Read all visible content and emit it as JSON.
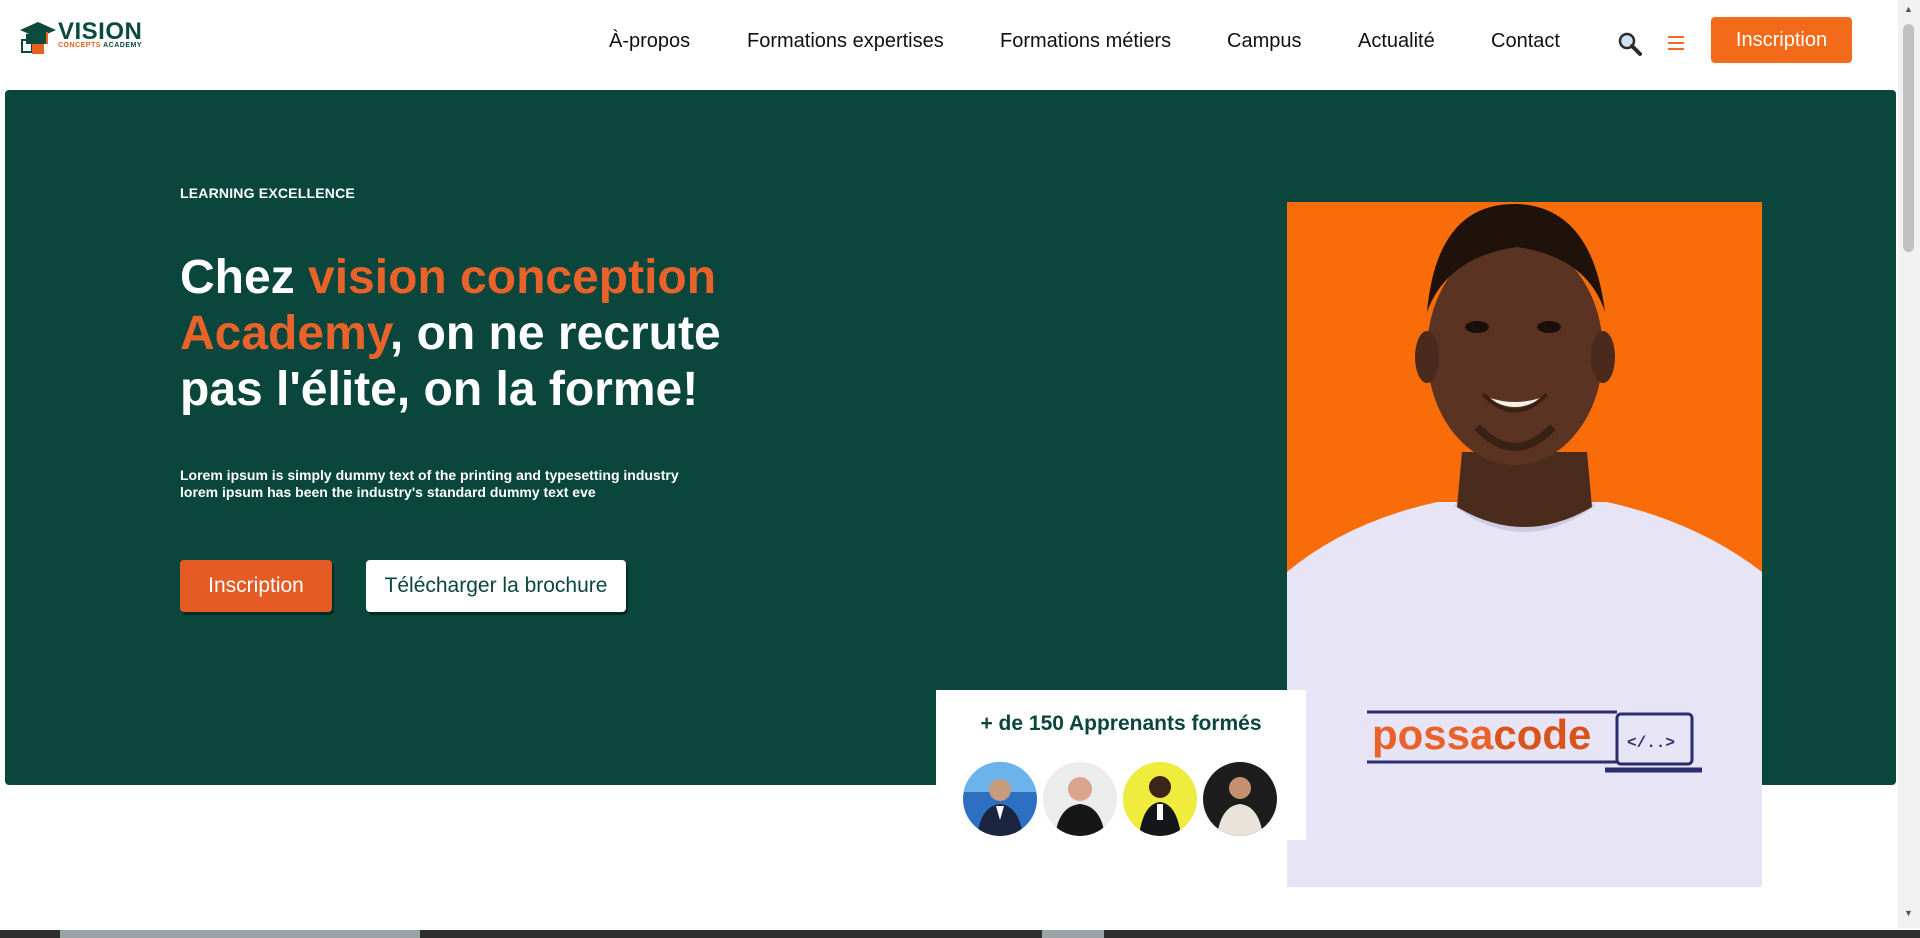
{
  "header": {
    "logo": {
      "main": "VISION",
      "sub_left": "CONCEPTS",
      "sub_right": "ACADEMY"
    },
    "nav": [
      "À-propos",
      "Formations expertises",
      "Formations métiers",
      "Campus",
      "Actualité",
      "Contact"
    ],
    "icons": [
      "search-icon",
      "menu-icon"
    ],
    "cta_label": "Inscription"
  },
  "hero": {
    "eyebrow": "LEARNING EXCELLENCE",
    "headline_pre": "Chez ",
    "headline_highlight": "vision conception Academy",
    "headline_post": ", on ne recrute pas l'élite, on la forme!",
    "description_line1": "Lorem ipsum is simply dummy text of the printing and typesetting industry",
    "description_line2": "lorem ipsum has been the industry's standard dummy text eve",
    "primary_button": "Inscription",
    "secondary_button": "Télécharger la brochure"
  },
  "photo": {
    "shirt_text_left": "possa",
    "shirt_text_right": "code",
    "shirt_code": "</..>"
  },
  "learners": {
    "title": "+ de 150 Apprenants formés",
    "avatar_count": 4
  },
  "colors": {
    "dark_green": "#0b463c",
    "orange": "#f36b1a",
    "accent_orange": "#e8622a",
    "photo_bg": "#f96c0a"
  }
}
